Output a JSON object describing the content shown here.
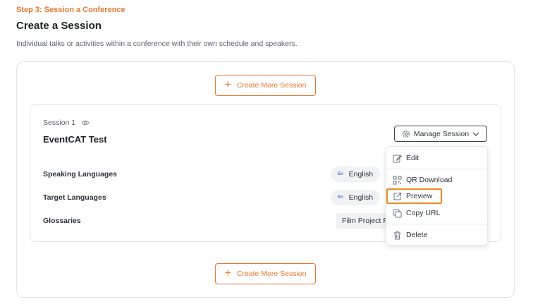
{
  "header": {
    "step": "Step 3: Session a Conference",
    "title": "Create a Session",
    "description": "Individual talks or activities within a conference with their own schedule and speakers."
  },
  "actions": {
    "create_more_label": "Create More Session"
  },
  "session": {
    "number_label": "Session 1",
    "name": "EventCAT Test",
    "manage_label": "Manage Session",
    "rows": [
      {
        "label": "Speaking Languages",
        "value": "English",
        "code": "En"
      },
      {
        "label": "Target Languages",
        "value": "English",
        "code": "En"
      },
      {
        "label": "Glossaries",
        "value": "Film Project F"
      }
    ]
  },
  "menu": {
    "items": [
      {
        "label": "Edit",
        "icon": "edit-icon"
      },
      {
        "label": "QR Download",
        "icon": "qr-code-icon"
      },
      {
        "label": "Preview",
        "icon": "external-link-icon"
      },
      {
        "label": "Copy URL",
        "icon": "copy-icon"
      },
      {
        "label": "Delete",
        "icon": "trash-icon"
      }
    ]
  },
  "colors": {
    "accent": "#e8772e",
    "highlight": "#f08a24",
    "text": "#1f2328",
    "muted": "#5b6068",
    "border": "#e3e4e8"
  }
}
